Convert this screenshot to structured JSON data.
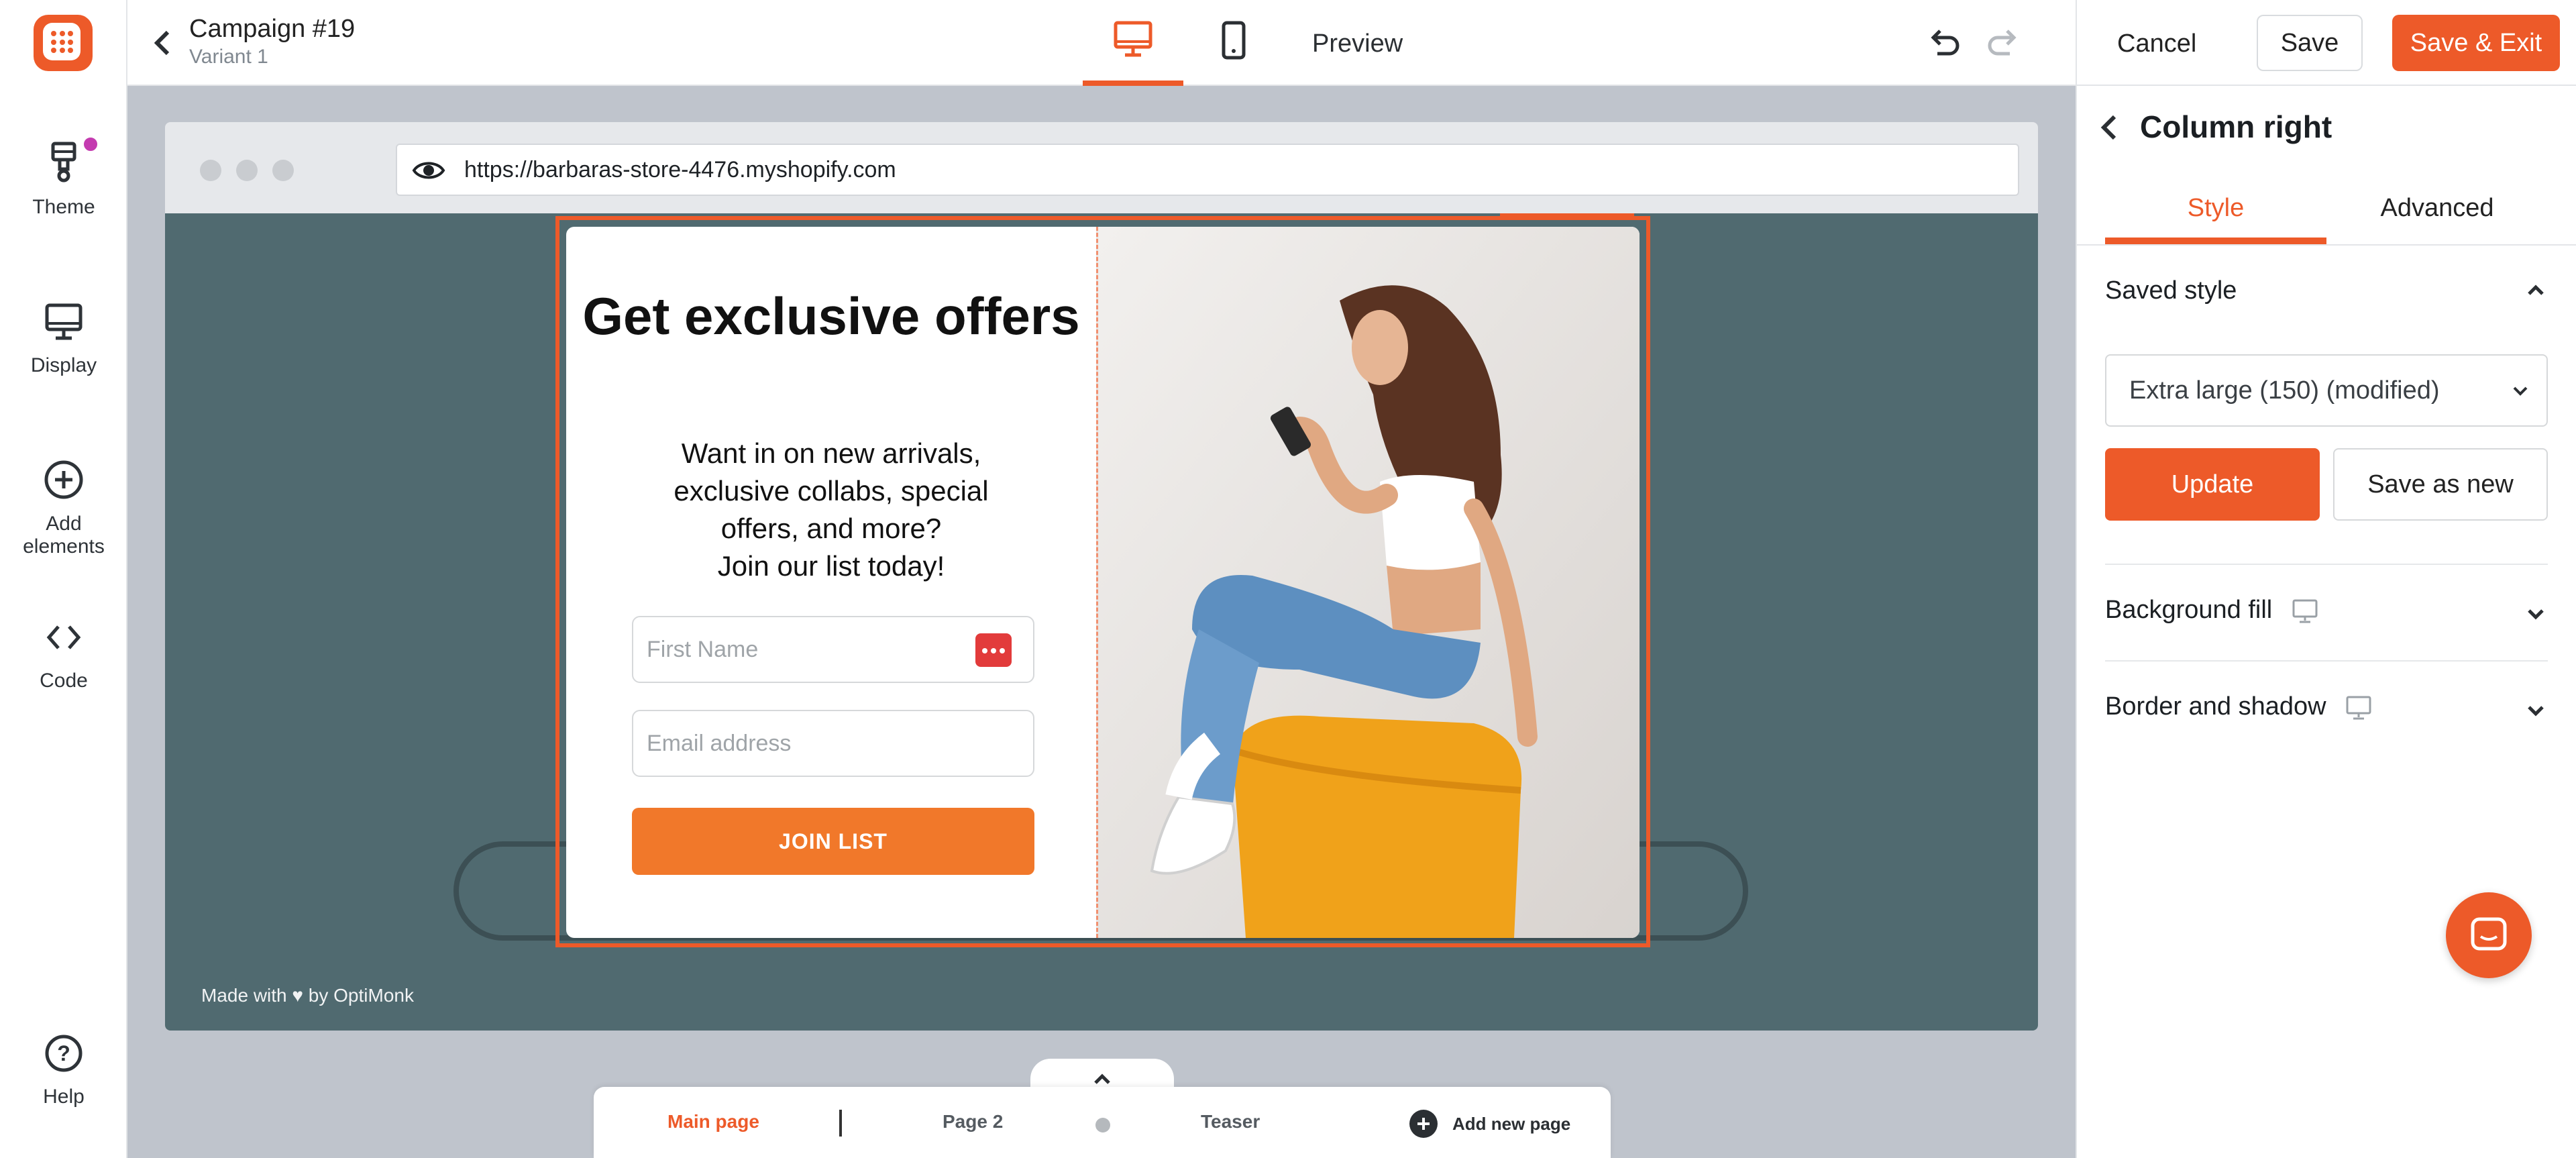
{
  "sidebar": {
    "items": [
      {
        "label": "Theme",
        "icon": "paint-brush-icon"
      },
      {
        "label": "Display",
        "icon": "monitor-icon"
      },
      {
        "label": "Add elements",
        "icon": "plus-circle-icon"
      },
      {
        "label": "Code",
        "icon": "code-icon"
      },
      {
        "label": "Help",
        "icon": "help-icon"
      }
    ]
  },
  "header": {
    "campaign_title": "Campaign #19",
    "variant": "Variant 1",
    "preview_label": "Preview",
    "cancel_label": "Cancel",
    "save_label": "Save",
    "save_exit_label": "Save & Exit"
  },
  "browser": {
    "url": "https://barbaras-store-4476.myshopify.com"
  },
  "popup": {
    "title": "Get exclusive offers",
    "desc_line1": "Want in on new arrivals,",
    "desc_line2": "exclusive collabs, special",
    "desc_line3": "offers, and more?",
    "desc_line4": "Join our list today!",
    "first_name_placeholder": "First Name",
    "email_placeholder": "Email address",
    "button_label": "JOIN LIST"
  },
  "site": {
    "made_with": "Made with ♥ by OptiMonk"
  },
  "pages": {
    "tabs": [
      {
        "label": "Main page",
        "active": true
      },
      {
        "label": "Page 2",
        "active": false
      },
      {
        "label": "Teaser",
        "active": false
      }
    ],
    "add_label": "Add new page"
  },
  "panel": {
    "title": "Column right",
    "tabs": [
      {
        "label": "Style",
        "active": true
      },
      {
        "label": "Advanced",
        "active": false
      }
    ],
    "saved_style_label": "Saved style",
    "style_select_value": "Extra large (150) (modified)",
    "update_label": "Update",
    "save_as_new_label": "Save as new",
    "background_fill_label": "Background fill",
    "border_shadow_label": "Border and shadow"
  },
  "colors": {
    "accent": "#ed5a29",
    "button_orange": "#f1782a",
    "site_bg": "#506a70"
  }
}
